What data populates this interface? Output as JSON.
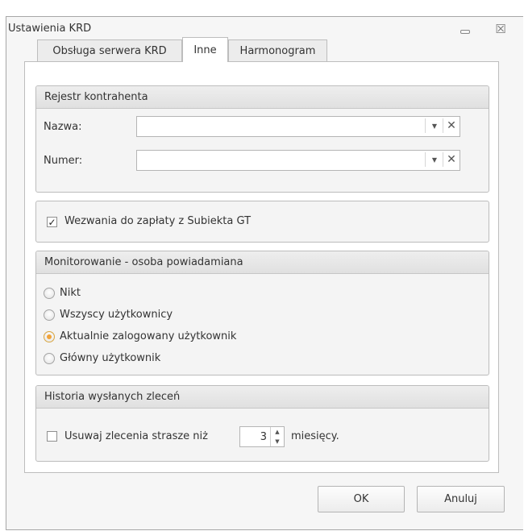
{
  "window": {
    "title": "Ustawienia KRD",
    "minimize_icon": "minimize-icon",
    "close_glyph": "☒"
  },
  "tabs": [
    {
      "label": "Obsługa serwera KRD",
      "active": false
    },
    {
      "label": "Inne",
      "active": true
    },
    {
      "label": "Harmonogram",
      "active": false
    }
  ],
  "rejestr": {
    "header": "Rejestr kontrahenta",
    "nazwa_label": "Nazwa:",
    "nazwa_value": "",
    "numer_label": "Numer:",
    "numer_value": "",
    "dropdown_glyph": "▼",
    "clear_glyph": "✕"
  },
  "wezwania": {
    "label": "Wezwania do zapłaty z Subiekta GT",
    "checked": true,
    "check_glyph": "✓"
  },
  "monitorowanie": {
    "header": "Monitorowanie - osoba powiadamiana",
    "options": [
      {
        "label": "Nikt",
        "checked": false
      },
      {
        "label": "Wszyscy użytkownicy",
        "checked": false
      },
      {
        "label": "Aktualnie zalogowany użytkownik",
        "checked": true
      },
      {
        "label": "Główny użytkownik",
        "checked": false
      }
    ]
  },
  "historia": {
    "header": "Historia wysłanych zleceń",
    "usuwaj_label": "Usuwaj zlecenia strasze niż",
    "usuwaj_checked": false,
    "months_value": "3",
    "months_suffix": "miesięcy.",
    "spin_up_glyph": "▲",
    "spin_down_glyph": "▼"
  },
  "buttons": {
    "ok": "OK",
    "cancel": "Anuluj"
  }
}
